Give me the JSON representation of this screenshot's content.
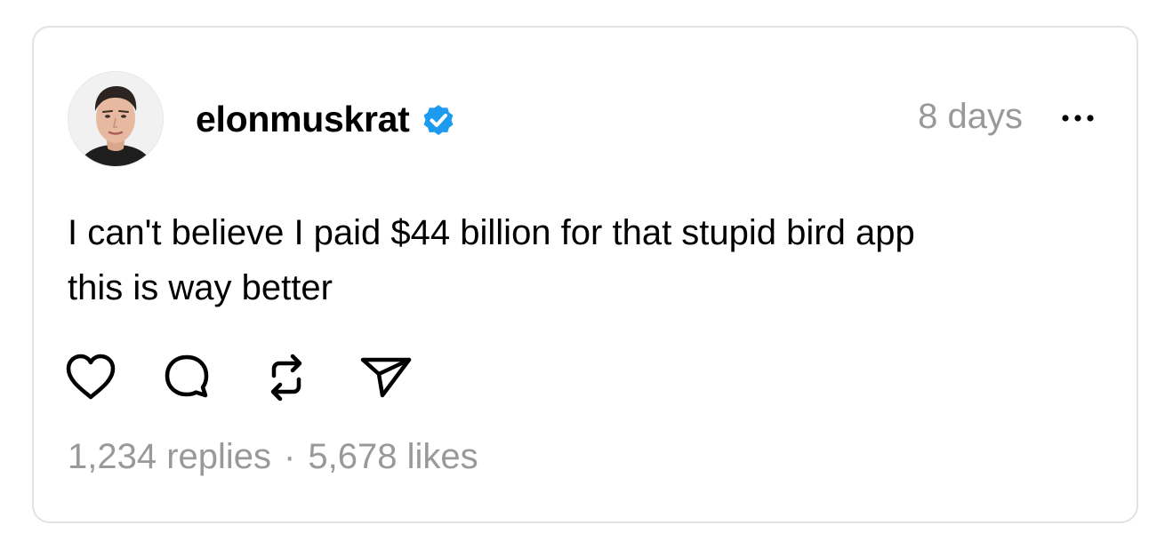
{
  "post": {
    "username": "elonmuskrat",
    "timestamp": "8 days",
    "text": "I can't believe I paid $44 billion for that stupid bird app\nthis is way better",
    "stats": {
      "replies": "1,234 replies",
      "separator": "·",
      "likes": "5,678 likes"
    }
  },
  "icons": {
    "verified": "verified-badge-icon",
    "more": "more-options-icon",
    "like": "heart-icon",
    "reply": "comment-bubble-icon",
    "repost": "repost-icon",
    "share": "send-icon"
  },
  "colors": {
    "text": "#000000",
    "muted": "#999999",
    "border": "#e2e2e2",
    "verified": "#1d9bf0"
  }
}
